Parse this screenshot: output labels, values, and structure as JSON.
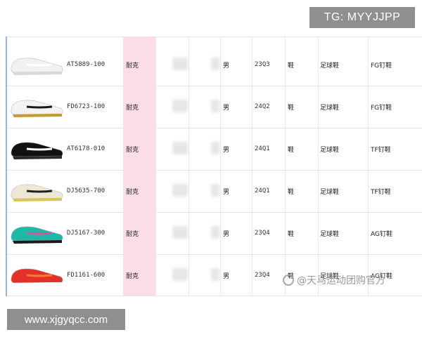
{
  "watermarks": {
    "top_right": "TG: MYYJJPP",
    "bottom_left": "www.xjgyqcc.com",
    "overlay_badge": "@天马运动团购官方"
  },
  "table": {
    "rows": [
      {
        "sku": "AT5889-100",
        "brand": "耐克",
        "gender": "男",
        "season": "23Q3",
        "kind": "鞋",
        "category": "足球鞋",
        "type": "FG钉鞋",
        "shoe_color": "white"
      },
      {
        "sku": "FD6723-100",
        "brand": "耐克",
        "gender": "男",
        "season": "24Q2",
        "kind": "鞋",
        "category": "足球鞋",
        "type": "FG钉鞋",
        "shoe_color": "white-black-gold"
      },
      {
        "sku": "AT6178-010",
        "brand": "耐克",
        "gender": "男",
        "season": "24Q1",
        "kind": "鞋",
        "category": "足球鞋",
        "type": "TF钉鞋",
        "shoe_color": "black-white"
      },
      {
        "sku": "DJ5635-700",
        "brand": "耐克",
        "gender": "男",
        "season": "24Q1",
        "kind": "鞋",
        "category": "足球鞋",
        "type": "TF钉鞋",
        "shoe_color": "cream-yellow"
      },
      {
        "sku": "DJ5167-300",
        "brand": "耐克",
        "gender": "男",
        "season": "23Q4",
        "kind": "鞋",
        "category": "足球鞋",
        "type": "AG钉鞋",
        "shoe_color": "teal-pink"
      },
      {
        "sku": "FD1161-600",
        "brand": "耐克",
        "gender": "男",
        "season": "23Q4",
        "kind": "鞋",
        "category": "足球鞋",
        "type": "AG钉鞋",
        "shoe_color": "red-orange"
      }
    ]
  },
  "colors": {
    "brand_column": "#fbdde7",
    "grid": "#e3e3e3",
    "watermark_bg": "#8f8f8f"
  }
}
